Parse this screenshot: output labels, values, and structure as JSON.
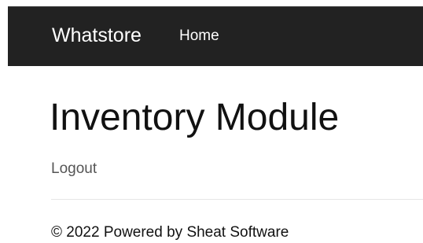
{
  "navbar": {
    "brand": "Whatstore",
    "links": [
      {
        "label": "Home"
      }
    ]
  },
  "main": {
    "title": "Inventory Module",
    "logout_label": "Logout"
  },
  "footer": {
    "text": "© 2022 Powered by Sheat Software"
  },
  "colors": {
    "navbar_background": "#222222",
    "navbar_text": "#ffffff",
    "body_text": "#111111",
    "muted_text": "#555555"
  }
}
